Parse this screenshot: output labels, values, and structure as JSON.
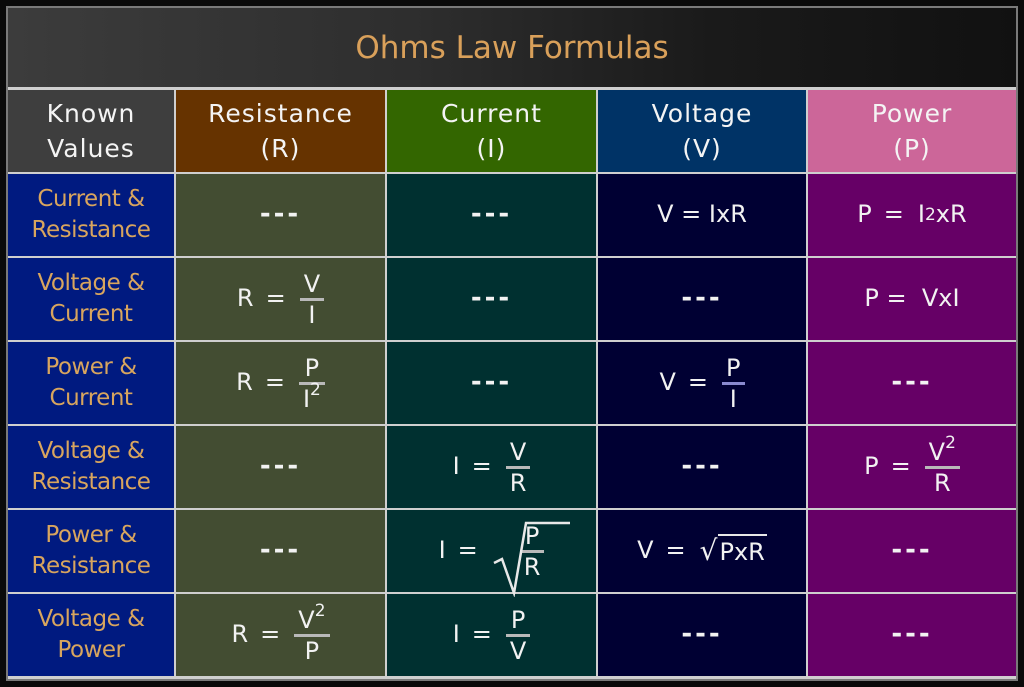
{
  "title": "Ohms Law Formulas",
  "headers": [
    {
      "line1": "Known",
      "line2": "Values"
    },
    {
      "line1": "Resistance",
      "line2": "(R)"
    },
    {
      "line1": "Current",
      "line2": "(I)"
    },
    {
      "line1": "Voltage",
      "line2": "(V)"
    },
    {
      "line1": "Power",
      "line2": "(P)"
    }
  ],
  "colors": {
    "title_text": "#d9a05a",
    "header_known": "#3e3e3e",
    "header_resistance": "#663300",
    "header_current": "#336600",
    "header_voltage": "#003366",
    "header_power": "#cc6699",
    "body_known": "#001a80",
    "body_resistance": "#434d32",
    "body_current": "#003030",
    "body_voltage": "#000033",
    "body_power": "#660066"
  },
  "empty_marker": "---",
  "rows": [
    {
      "known": {
        "line1": "Current &",
        "line2": "Resistance"
      },
      "resistance": "---",
      "current": "---",
      "voltage": {
        "text": "V = IxR"
      },
      "power": {
        "lhs": "P",
        "eq": "=",
        "base": "I",
        "exp": "2",
        "rest": "xR"
      }
    },
    {
      "known": {
        "line1": "Voltage &",
        "line2": "Current"
      },
      "resistance": {
        "lhs": "R",
        "eq": "=",
        "num": "V",
        "den": "I"
      },
      "current": "---",
      "voltage": "---",
      "power": {
        "text": "P =  VxI"
      }
    },
    {
      "known": {
        "line1": "Power &",
        "line2": "Current"
      },
      "resistance": {
        "lhs": "R",
        "eq": "=",
        "num": "P",
        "den": "I",
        "den_exp": "2"
      },
      "current": "---",
      "voltage": {
        "lhs": "V",
        "eq": "=",
        "num": "P",
        "den": "I"
      },
      "power": "---"
    },
    {
      "known": {
        "line1": "Voltage &",
        "line2": "Resistance"
      },
      "resistance": "---",
      "current": {
        "lhs": "I",
        "eq": "=",
        "num": "V",
        "den": "R"
      },
      "voltage": "---",
      "power": {
        "lhs": "P",
        "eq": "=",
        "num": "V",
        "num_exp": "2",
        "den": "R"
      }
    },
    {
      "known": {
        "line1": "Power &",
        "line2": "Resistance"
      },
      "resistance": "---",
      "current": {
        "lhs": "I",
        "eq": "=",
        "num": "P",
        "den": "R",
        "sqrt": true
      },
      "voltage": {
        "lhs": "V",
        "eq": "=",
        "root": "√",
        "radicand": "PxR"
      },
      "power": "---"
    },
    {
      "known": {
        "line1": "Voltage &",
        "line2": "Power"
      },
      "resistance": {
        "lhs": "R",
        "eq": "=",
        "num": "V",
        "num_exp": "2",
        "den": "P"
      },
      "current": {
        "lhs": "I",
        "eq": "=",
        "num": "P",
        "den": "V"
      },
      "voltage": "---",
      "power": "---"
    }
  ]
}
